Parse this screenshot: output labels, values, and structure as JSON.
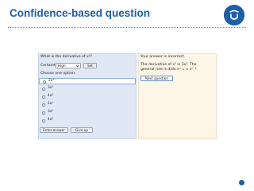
{
  "slide": {
    "title": "Confidence-based question"
  },
  "question": {
    "prompt": "What is the derivative of x³?",
    "certainty_label": "Certainty:",
    "certainty_value": "High",
    "set_label": "Set",
    "choose_label": "Choose one option:",
    "options": [
      "2x³",
      "3x³",
      "4x³",
      "2x²",
      "3x²",
      "4x²"
    ],
    "selected_index": 0,
    "enter_answer_label": "Enter answer",
    "give_up_label": "Give up"
  },
  "feedback": {
    "line1": "Your answer is incorrect.",
    "line2": "The derivative of x³ is 3x². The",
    "line3": "general rule is d/dx xⁿ = n xⁿ⁻¹",
    "next_label": "Next question"
  },
  "colors": {
    "title": "#1d5fa8",
    "question_panel": "#dfe8f4",
    "feedback_panel": "#fdf5e6"
  },
  "icons": {
    "logo": "open-university-logo",
    "dropdown": "chevron-down-icon",
    "page_marker": "page-dot"
  }
}
